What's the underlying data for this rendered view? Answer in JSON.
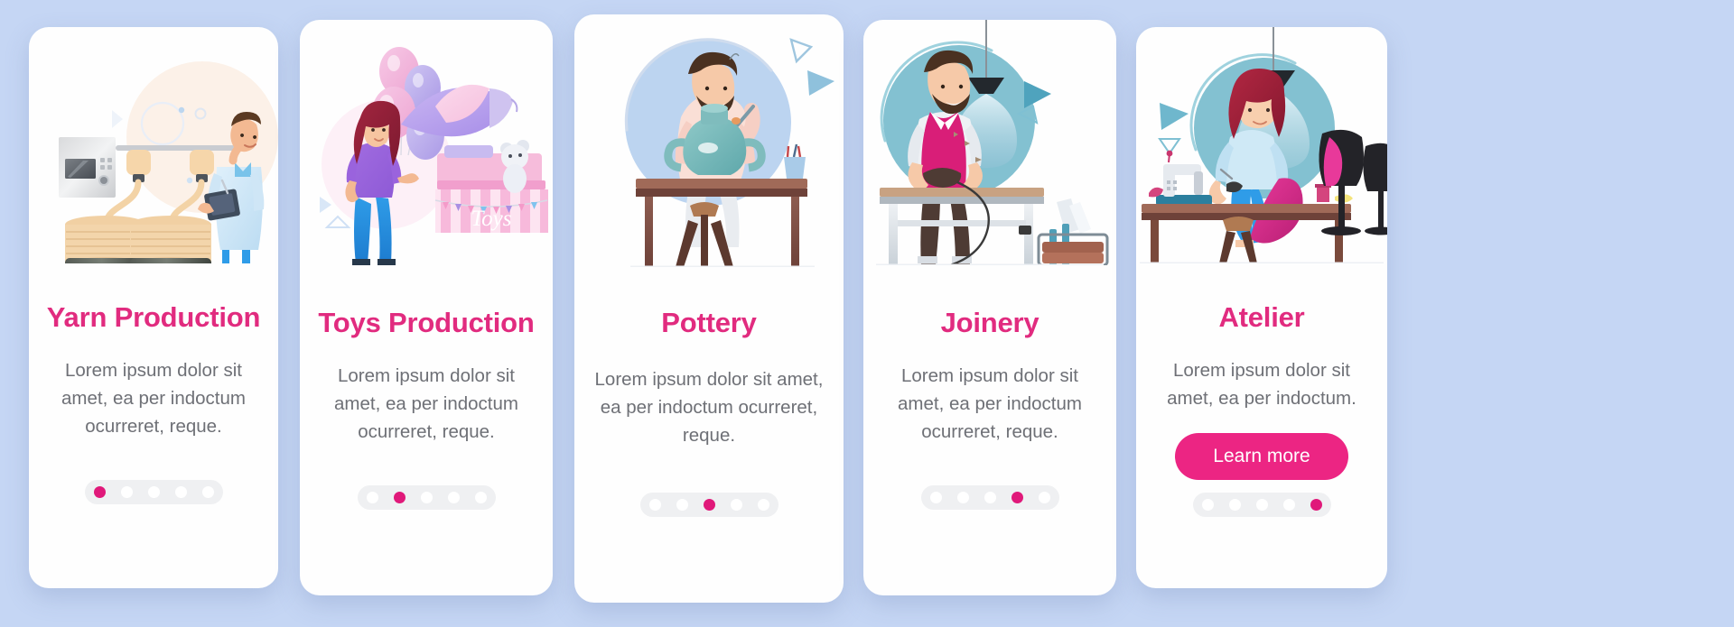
{
  "page": {
    "background_color": "#c5d6f4",
    "card_background": "#fefefe",
    "accent_color": "#e12b7f",
    "cta_color": "#ec2583",
    "body_text_color": "#6e7076",
    "pager_track_color": "#eff0f2",
    "pager_dot_color": "#ffffff",
    "pager_dot_active_color": "#e0197a"
  },
  "screens": [
    {
      "id": "yarn-production",
      "title": "Yarn Production",
      "description": "Lorem ipsum dolor sit amet, ea per indoctum ocurreret, reque.",
      "illustration": "yarn-production-illustration",
      "pager": {
        "total": 5,
        "active": 1
      },
      "cta": null
    },
    {
      "id": "toys-production",
      "title": "Toys Production",
      "description": "Lorem ipsum dolor sit amet, ea per indoctum ocurreret, reque.",
      "illustration": "toys-production-illustration",
      "illustration_sign": "Toys",
      "pager": {
        "total": 5,
        "active": 2
      },
      "cta": null
    },
    {
      "id": "pottery",
      "title": "Pottery",
      "description": "Lorem ipsum dolor sit amet, ea per indoctum ocurreret, reque.",
      "illustration": "pottery-illustration",
      "pager": {
        "total": 5,
        "active": 3
      },
      "cta": null
    },
    {
      "id": "joinery",
      "title": "Joinery",
      "description": "Lorem ipsum dolor sit amet, ea per indoctum ocurreret, reque.",
      "illustration": "joinery-illustration",
      "pager": {
        "total": 5,
        "active": 4
      },
      "cta": null
    },
    {
      "id": "atelier",
      "title": "Atelier",
      "description": "Lorem ipsum dolor sit amet, ea per indoctum.",
      "illustration": "atelier-illustration",
      "pager": {
        "total": 5,
        "active": 5
      },
      "cta": "Learn more"
    }
  ]
}
